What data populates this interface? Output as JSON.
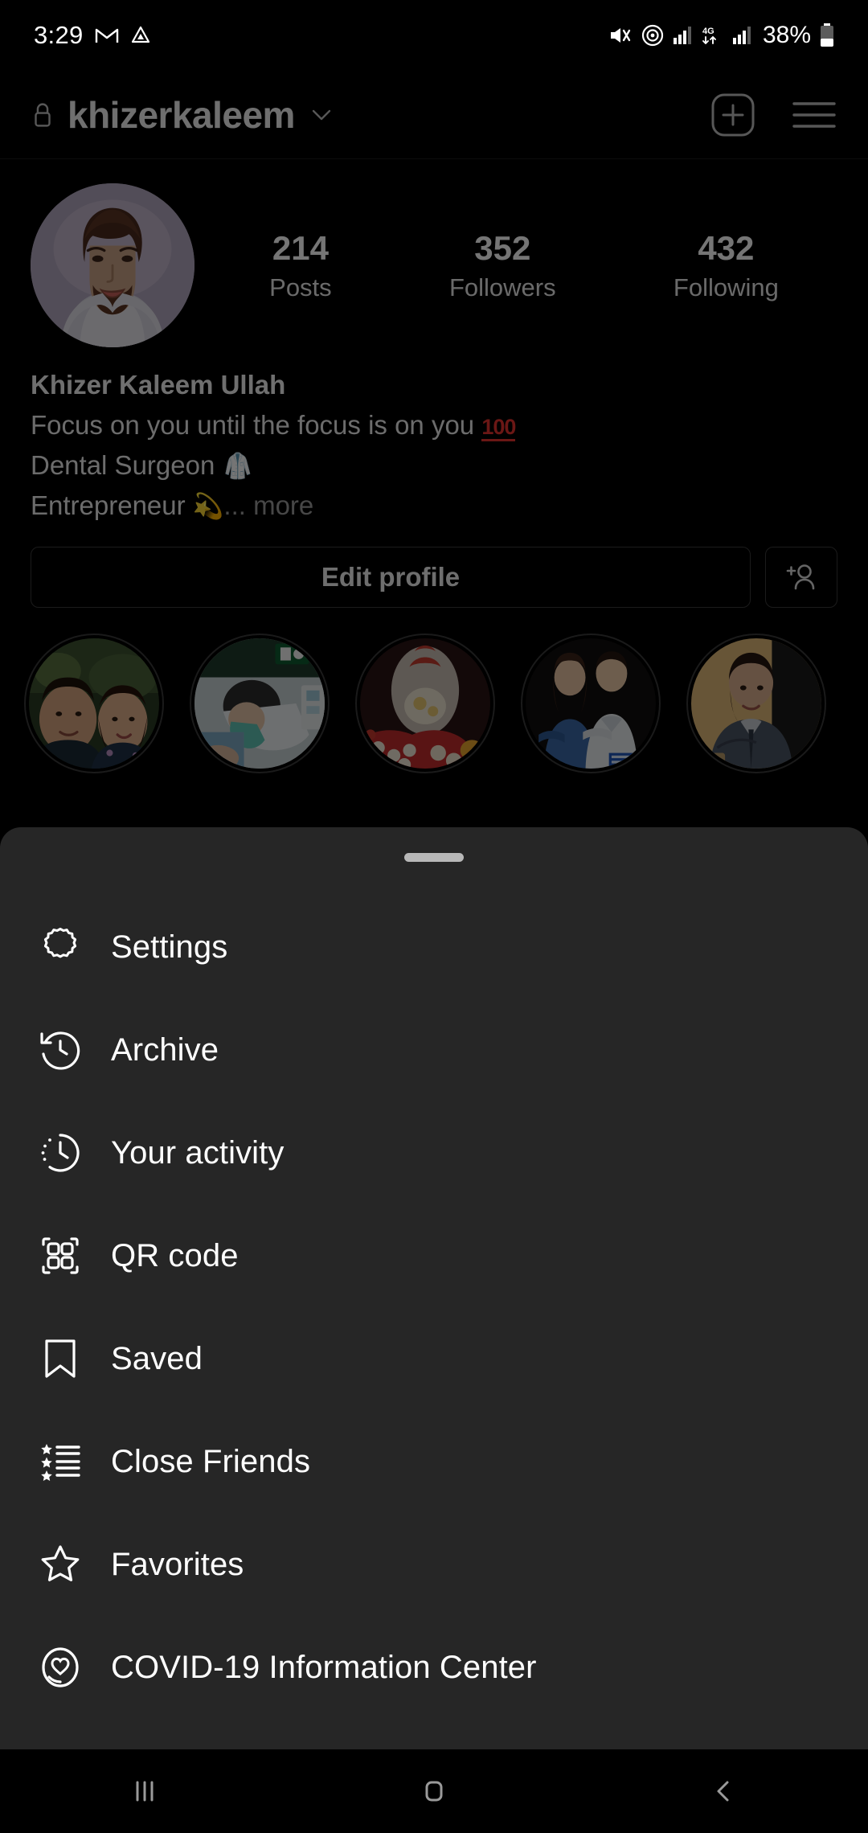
{
  "status_bar": {
    "time": "3:29",
    "battery_percent": "38%",
    "network_type": "4G",
    "icons": [
      "gmail-icon",
      "google-drive-icon",
      "mute-icon",
      "hotspot-icon",
      "signal-bars-icon",
      "mobile-data-icon",
      "signal-bars-2-icon",
      "battery-icon"
    ]
  },
  "header": {
    "username": "khizerkaleem",
    "lock_icon": "lock-icon",
    "chevron_icon": "chevron-down-icon",
    "add_post_icon": "add-post-icon",
    "menu_icon": "hamburger-menu-icon"
  },
  "profile": {
    "avatar_alt": "profile-avatar",
    "stats": [
      {
        "value": "214",
        "label": "Posts"
      },
      {
        "value": "352",
        "label": "Followers"
      },
      {
        "value": "432",
        "label": "Following"
      }
    ],
    "display_name": "Khizer Kaleem Ullah",
    "bio_lines": [
      {
        "text": "Focus on you until the focus is on you ",
        "emoji": "100"
      },
      {
        "text": "Dental Surgeon ",
        "emoji": "lab-coat"
      },
      {
        "text": "Entrepreneur ",
        "emoji": "dizzy"
      }
    ],
    "bio_more": "... more",
    "edit_profile_label": "Edit profile",
    "add_person_icon": "add-person-icon",
    "highlights_count": 5
  },
  "sheet": {
    "handle": "drag-handle",
    "items": [
      {
        "label": "Settings",
        "icon": "gear-icon"
      },
      {
        "label": "Archive",
        "icon": "archive-clock-icon"
      },
      {
        "label": "Your activity",
        "icon": "activity-clock-icon"
      },
      {
        "label": "QR code",
        "icon": "qr-code-icon"
      },
      {
        "label": "Saved",
        "icon": "bookmark-icon"
      },
      {
        "label": "Close Friends",
        "icon": "star-list-icon"
      },
      {
        "label": "Favorites",
        "icon": "star-icon"
      },
      {
        "label": "COVID-19 Information Center",
        "icon": "covid-heart-icon"
      }
    ]
  },
  "navbar": {
    "recents_icon": "recents-icon",
    "home_icon": "home-icon",
    "back_icon": "back-icon"
  },
  "colors": {
    "background": "#000000",
    "sheet_background": "#262626",
    "text_primary": "#ffffff",
    "accent_red": "#e8332e",
    "avatar_background": "#b0a6bd"
  }
}
